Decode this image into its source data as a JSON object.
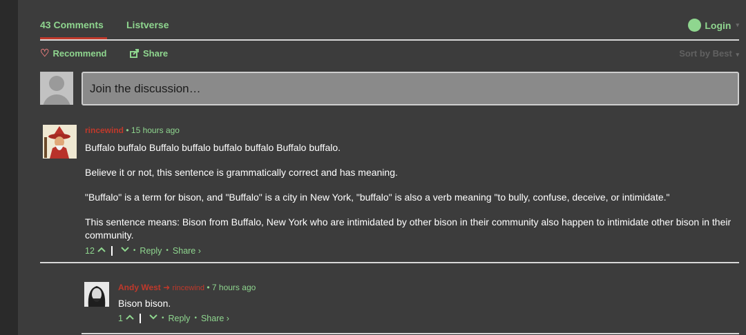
{
  "tabs": {
    "comments_label": "43 Comments",
    "site_label": "Listverse",
    "login_label": "Login"
  },
  "actions": {
    "recommend_label": "Recommend",
    "share_label": "Share",
    "sort_label": "Sort by Best"
  },
  "composer": {
    "placeholder": "Join the discussion…"
  },
  "icons": {
    "heart": "heart-icon",
    "share": "share-icon",
    "login": "login-dot-icon",
    "upvote": "chevron-up-icon",
    "downvote": "chevron-down-icon"
  },
  "colors": {
    "background": "#3c3c3c",
    "accent_green": "#8fd68f",
    "author_red": "#c0392b",
    "input_bg": "#8a8a8a"
  },
  "comments": [
    {
      "author": "rincewind",
      "time": "15 hours ago",
      "paragraphs": [
        "Buffalo buffalo Buffalo buffalo buffalo buffalo Buffalo buffalo.",
        "Believe it or not, this sentence is grammatically correct and has meaning.",
        "\"Buffalo\" is a term for bison, and \"Buffalo\" is a city in New York, \"buffalo\" is also a verb meaning \"to bully, confuse, deceive, or intimidate.\"",
        "This sentence means: Bison from Buffalo, New York who are intimidated by other bison in their community also happen to intimidate other bison in their community."
      ],
      "votes": "12",
      "reply_label": "Reply",
      "share_label": "Share ›"
    },
    {
      "author": "Andy West",
      "reply_to": "rincewind",
      "time": "7 hours ago",
      "paragraphs": [
        "Bison bison."
      ],
      "votes": "1",
      "reply_label": "Reply",
      "share_label": "Share ›"
    }
  ],
  "separators": {
    "dot": "•",
    "caret": "▾",
    "arrow": "➜",
    "up": "︿",
    "down": "﹀"
  }
}
